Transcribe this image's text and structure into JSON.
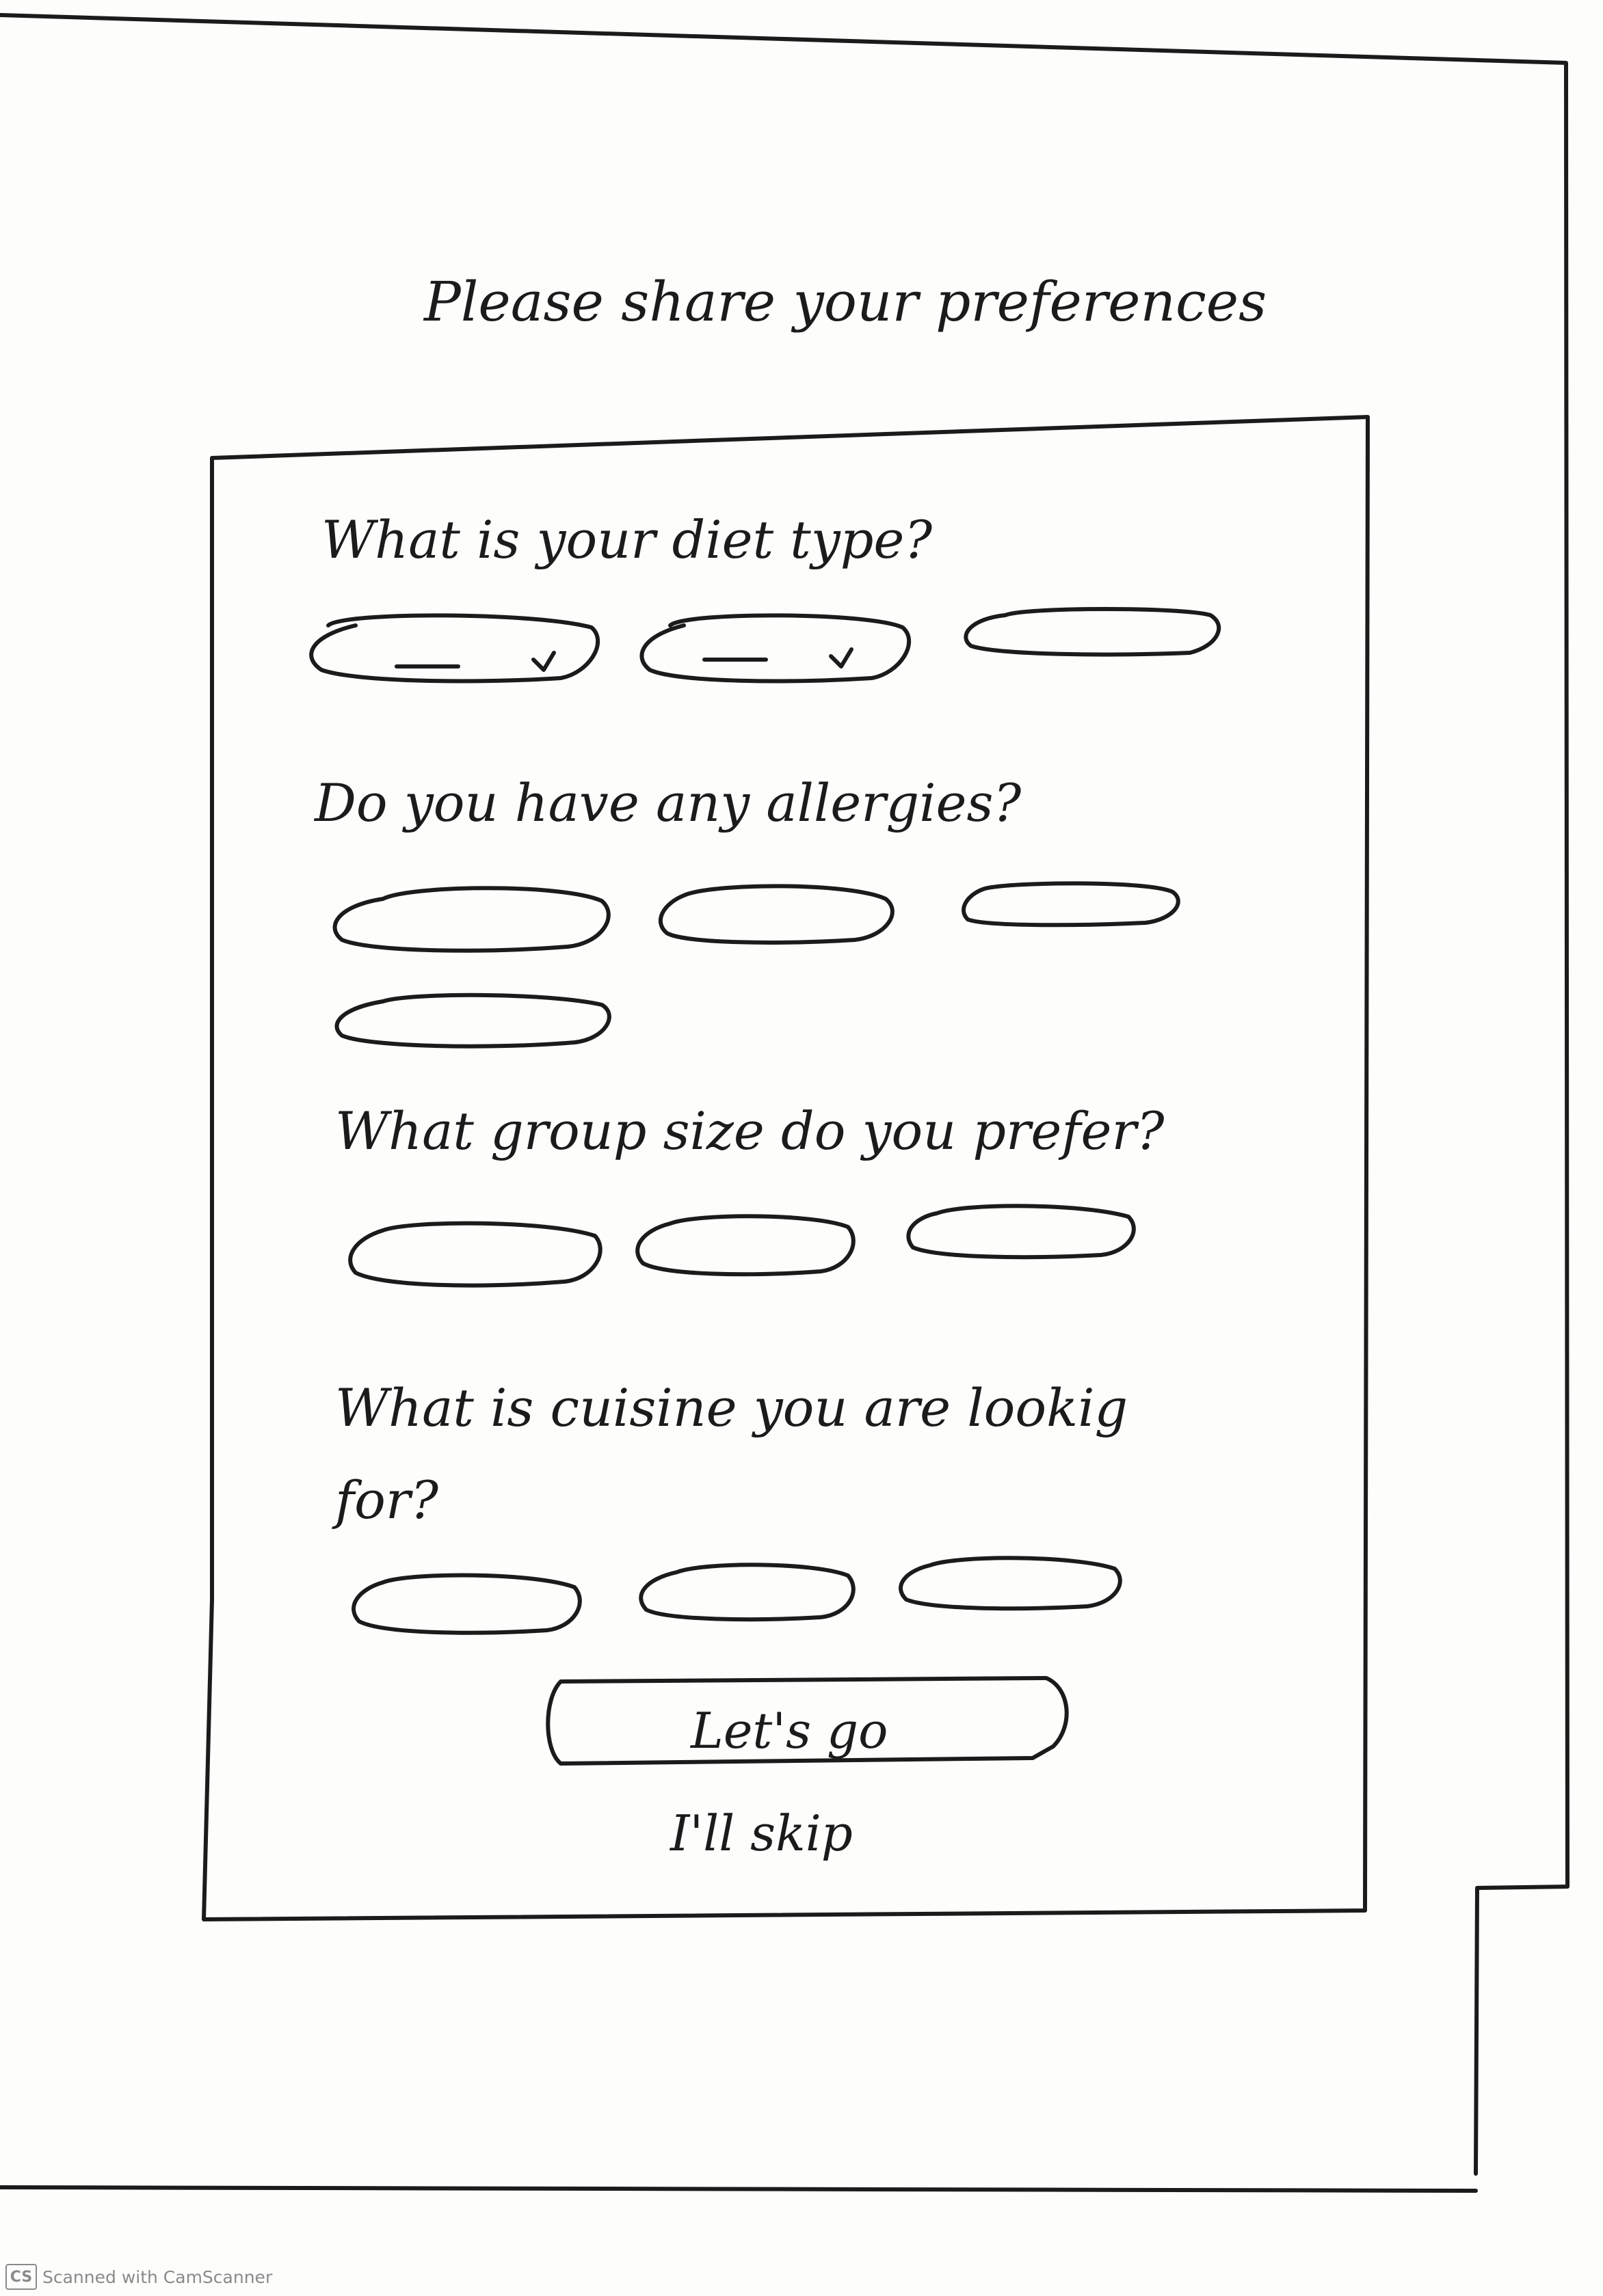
{
  "title": "Please share your preferences",
  "questions": {
    "diet": {
      "label": "What is your diet type?",
      "options": [
        {
          "name": "diet-option-1",
          "selected": true
        },
        {
          "name": "diet-option-2",
          "selected": true
        },
        {
          "name": "diet-option-3",
          "selected": false
        }
      ]
    },
    "allergies": {
      "label": "Do you have any allergies?",
      "options": [
        {
          "name": "allergy-option-1",
          "selected": false
        },
        {
          "name": "allergy-option-2",
          "selected": false
        },
        {
          "name": "allergy-option-3",
          "selected": false
        },
        {
          "name": "allergy-option-4",
          "selected": false
        }
      ]
    },
    "group_size": {
      "label": "What group size do you prefer?",
      "options": [
        {
          "name": "group-option-1",
          "selected": false
        },
        {
          "name": "group-option-2",
          "selected": false
        },
        {
          "name": "group-option-3",
          "selected": false
        }
      ]
    },
    "cuisine": {
      "label_line1": "What is cuisine you are lookig",
      "label_line2": "for?",
      "options": [
        {
          "name": "cuisine-option-1",
          "selected": false
        },
        {
          "name": "cuisine-option-2",
          "selected": false
        },
        {
          "name": "cuisine-option-3",
          "selected": false
        }
      ]
    }
  },
  "actions": {
    "primary_label": "Let's go",
    "secondary_label": "I'll skip"
  },
  "footer": {
    "logo_text": "CS",
    "text": "Scanned with CamScanner"
  },
  "colors": {
    "ink": "#1b1b1b",
    "paper": "#fdfdfc",
    "footer_text": "#8a8a8a"
  }
}
